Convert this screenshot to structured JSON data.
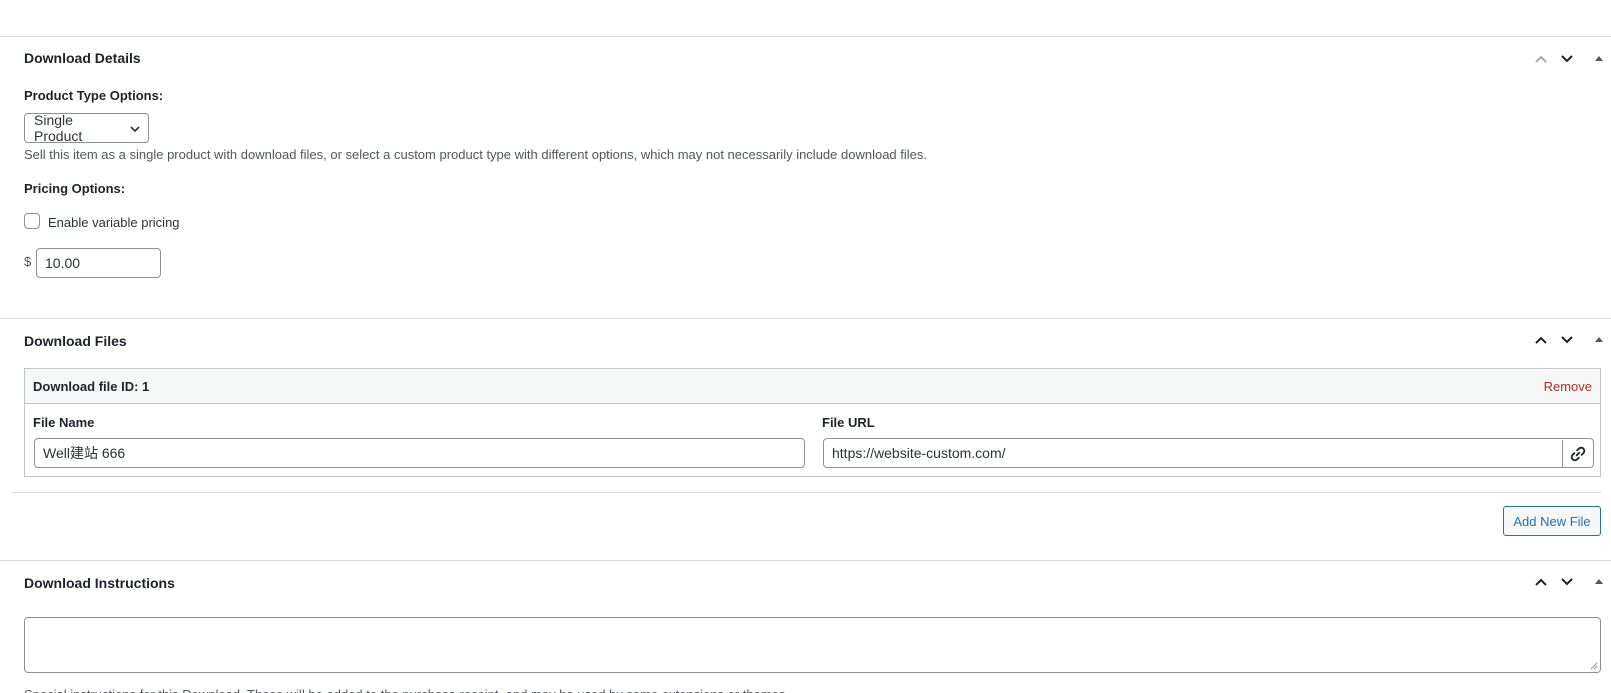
{
  "download_details": {
    "title": "Download Details",
    "product_type_label": "Product Type Options:",
    "product_type_selected": "Single Product",
    "product_type_description": "Sell this item as a single product with download files, or select a custom product type with different options, which may not necessarily include download files.",
    "pricing_label": "Pricing Options:",
    "variable_pricing_label": "Enable variable pricing",
    "variable_pricing_checked": false,
    "currency_symbol": "$",
    "price_value": "10.00"
  },
  "download_files": {
    "title": "Download Files",
    "files": [
      {
        "header": "Download file ID: 1",
        "remove_label": "Remove",
        "file_name_label": "File Name",
        "file_name_value": "Well建站 666",
        "file_url_label": "File URL",
        "file_url_value": "https://website-custom.com/"
      }
    ],
    "add_new_label": "Add New File"
  },
  "download_instructions": {
    "title": "Download Instructions",
    "value": "",
    "description_partial": "Special instructions for this Download. These will be added to the purchase receipt, and may be used by some extensions or themes."
  },
  "icons": {
    "move_up": "chevron-up-icon",
    "move_down": "chevron-down-icon",
    "toggle": "caret-up-icon",
    "select_arrow": "chevron-down-icon",
    "url_link": "link-icon",
    "resize": "resize-grip-icon"
  },
  "colors": {
    "accent": "#2271b1",
    "danger": "#b32d2e",
    "border": "#8c8f94",
    "divider": "#dcdcde",
    "panel_header_bg": "#f6f7f7",
    "disabled_icon": "#a7aaad"
  }
}
